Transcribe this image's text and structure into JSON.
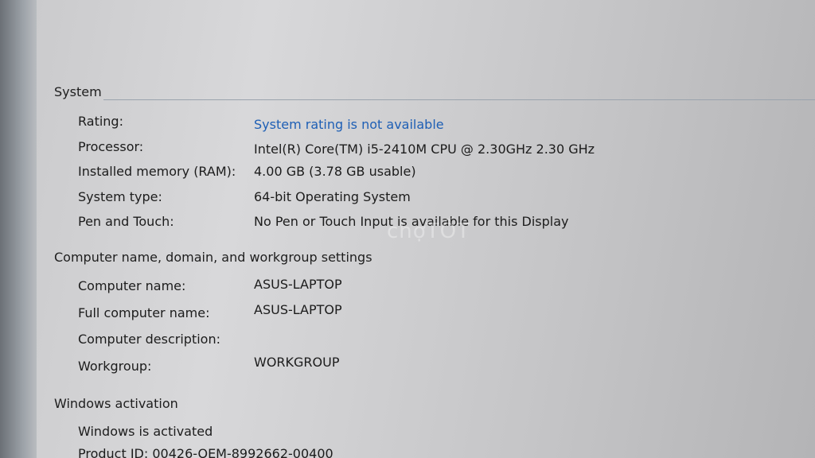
{
  "system": {
    "header": "System",
    "rating_label": "Rating:",
    "rating_value": "System rating is not available",
    "processor_label": "Processor:",
    "processor_value": "Intel(R) Core(TM) i5-2410M CPU @ 2.30GHz   2.30 GHz",
    "memory_label": "Installed memory (RAM):",
    "memory_value": "4.00 GB (3.78 GB usable)",
    "type_label": "System type:",
    "type_value": "64-bit Operating System",
    "pen_label": "Pen and Touch:",
    "pen_value": "No Pen or Touch Input is available for this Display"
  },
  "computer": {
    "header": "Computer name, domain, and workgroup settings",
    "name_label": "Computer name:",
    "name_value": "ASUS-LAPTOP",
    "full_name_label": "Full computer name:",
    "full_name_value": "ASUS-LAPTOP",
    "description_label": "Computer description:",
    "workgroup_label": "Workgroup:",
    "workgroup_value": "WORKGROUP"
  },
  "activation": {
    "header": "Windows activation",
    "status": "Windows is activated",
    "product_id": "Product ID: 00426-OEM-8992662-00400"
  },
  "watermark": "chợTỐT"
}
